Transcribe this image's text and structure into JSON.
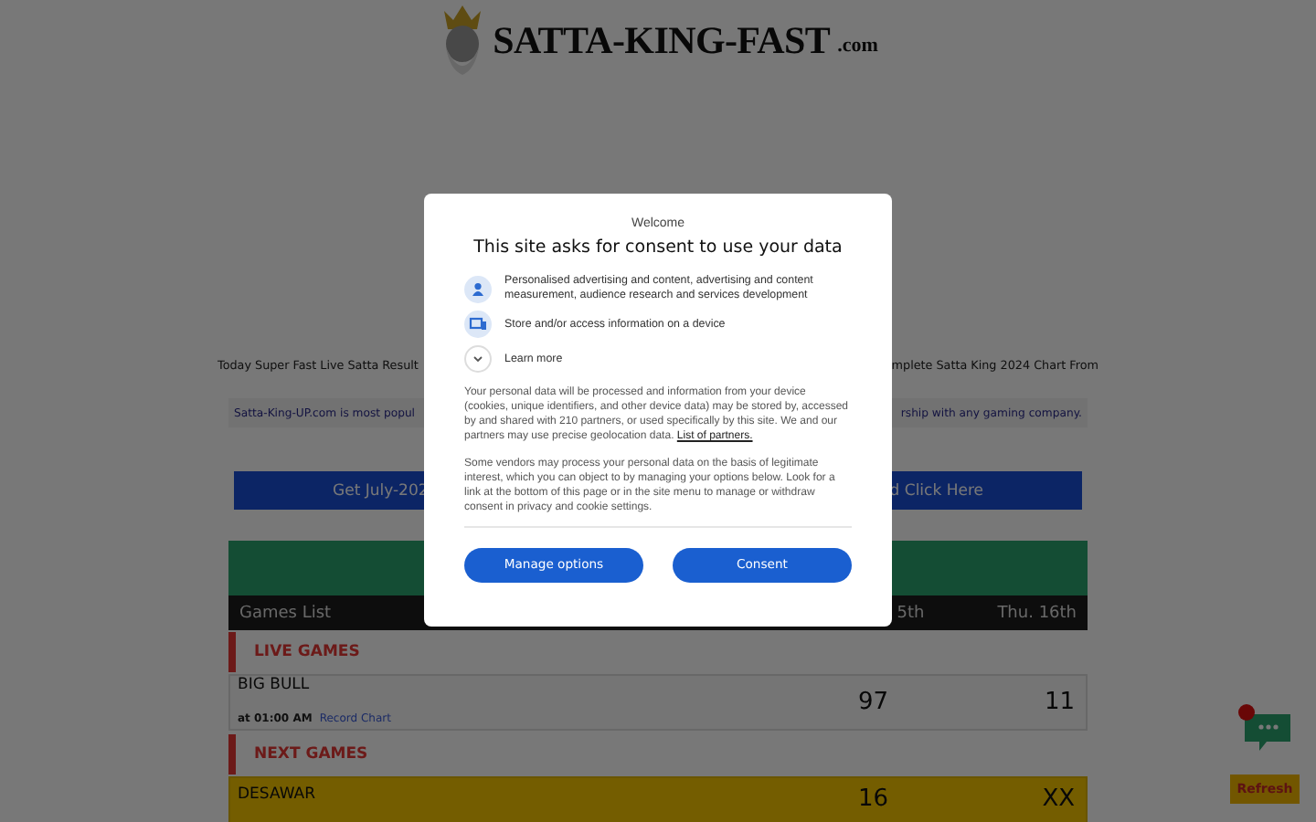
{
  "logo": {
    "name": "SATTA-KING-FAST",
    "suffix": ".com"
  },
  "intro": {
    "left": "Today Super Fast Live Satta Result",
    "right": "mplete Satta King 2024 Chart From"
  },
  "notice": {
    "left": "Satta-King-UP.com is most popul",
    "right": "rship with any gaming company."
  },
  "chart_banner": {
    "left": "Get July-202",
    "right": "d Click Here"
  },
  "games_header": {
    "label": "Games List",
    "columns": [
      "5th",
      "Thu. 16th"
    ]
  },
  "sections": [
    {
      "title": "LIVE GAMES",
      "games": [
        {
          "name": "BIG BULL",
          "time": "at 01:00 AM",
          "link": "Record Chart",
          "results": [
            "97",
            "11"
          ],
          "highlight": false
        }
      ]
    },
    {
      "title": "NEXT GAMES",
      "games": [
        {
          "name": "DESAWAR",
          "results": [
            "16",
            "XX"
          ],
          "highlight": true
        }
      ]
    }
  ],
  "chat": {
    "unread": true
  },
  "refresh": "Refresh",
  "consent": {
    "header": "Welcome",
    "title": "This site asks for consent to use your data",
    "purposes": [
      {
        "kind": "person",
        "text": "Personalised advertising and content, advertising and content measurement, audience research and services development"
      },
      {
        "kind": "device",
        "text": "Store and/or access information on a device"
      },
      {
        "kind": "expand",
        "text": "Learn more"
      }
    ],
    "paragraphs": [
      {
        "text": "Your personal data will be processed and information from your device (cookies, unique identifiers, and other device data) may be stored by, accessed by and shared with 210 partners, or used specifically by this site. We and our partners may use precise geolocation data.",
        "link": "List of partners."
      },
      {
        "text": "Some vendors may process your personal data on the basis of legitimate interest, which you can object to by managing your options below. Look for a link at the bottom of this page or in the site menu to manage or withdraw consent in privacy and cookie settings."
      }
    ],
    "buttons": [
      "Manage options",
      "Consent"
    ]
  }
}
